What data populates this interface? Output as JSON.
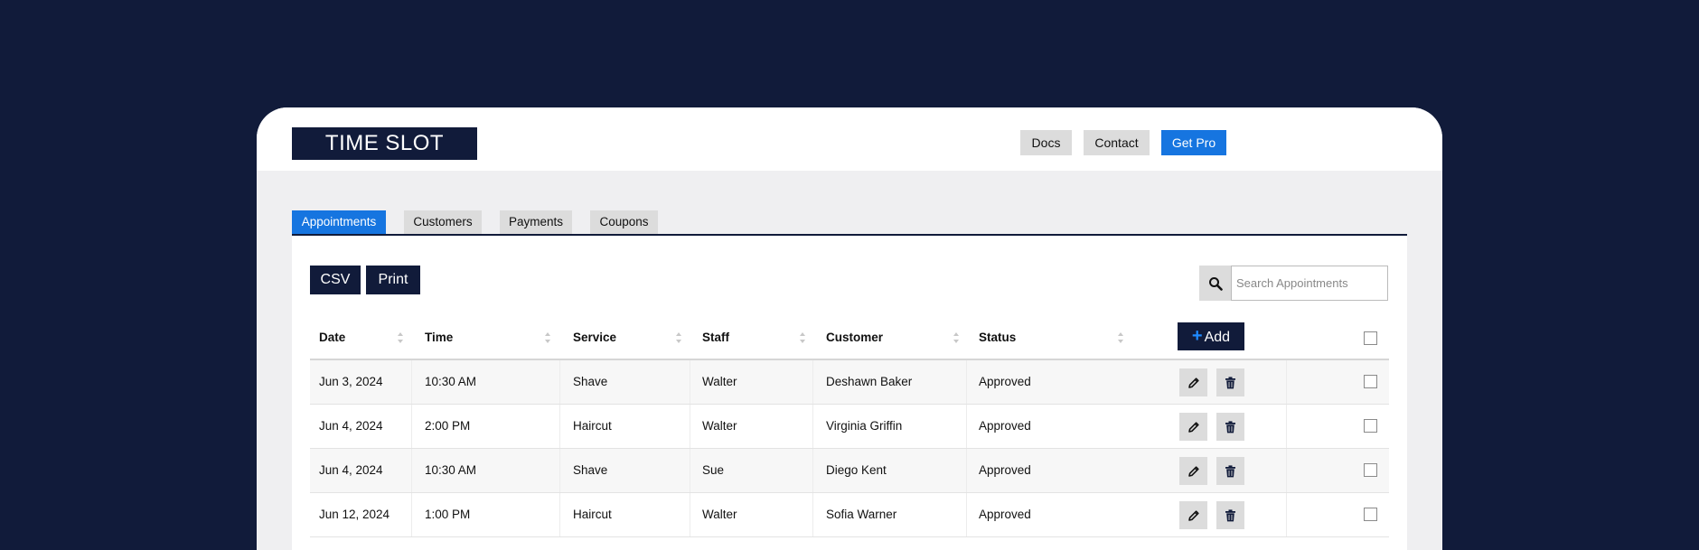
{
  "app": {
    "logo": "TIME SLOT"
  },
  "topnav": {
    "docs": "Docs",
    "contact": "Contact",
    "get_pro": "Get Pro"
  },
  "tabs": [
    {
      "label": "Appointments",
      "active": true
    },
    {
      "label": "Customers",
      "active": false
    },
    {
      "label": "Payments",
      "active": false
    },
    {
      "label": "Coupons",
      "active": false
    }
  ],
  "toolbar": {
    "csv": "CSV",
    "print": "Print"
  },
  "search": {
    "placeholder": "Search Appointments",
    "value": ""
  },
  "table": {
    "headers": {
      "date": "Date",
      "time": "Time",
      "service": "Service",
      "staff": "Staff",
      "customer": "Customer",
      "status": "Status"
    },
    "add_label": "Add",
    "rows": [
      {
        "date": "Jun 3, 2024",
        "time": "10:30 AM",
        "service": "Shave",
        "staff": "Walter",
        "customer": "Deshawn Baker",
        "status": "Approved"
      },
      {
        "date": "Jun 4, 2024",
        "time": "2:00 PM",
        "service": "Haircut",
        "staff": "Walter",
        "customer": "Virginia Griffin",
        "status": "Approved"
      },
      {
        "date": "Jun 4, 2024",
        "time": "10:30 AM",
        "service": "Shave",
        "staff": "Sue",
        "customer": "Diego Kent",
        "status": "Approved"
      },
      {
        "date": "Jun 12, 2024",
        "time": "1:00 PM",
        "service": "Haircut",
        "staff": "Walter",
        "customer": "Sofia Warner",
        "status": "Approved"
      }
    ]
  },
  "icons": {
    "search": "search-icon",
    "edit": "pencil-icon",
    "delete": "trash-icon",
    "sort": "sort-icon",
    "add": "plus-icon"
  },
  "colors": {
    "background": "#111b3a",
    "accent": "#1675e0",
    "dark_button": "#111b3a"
  }
}
